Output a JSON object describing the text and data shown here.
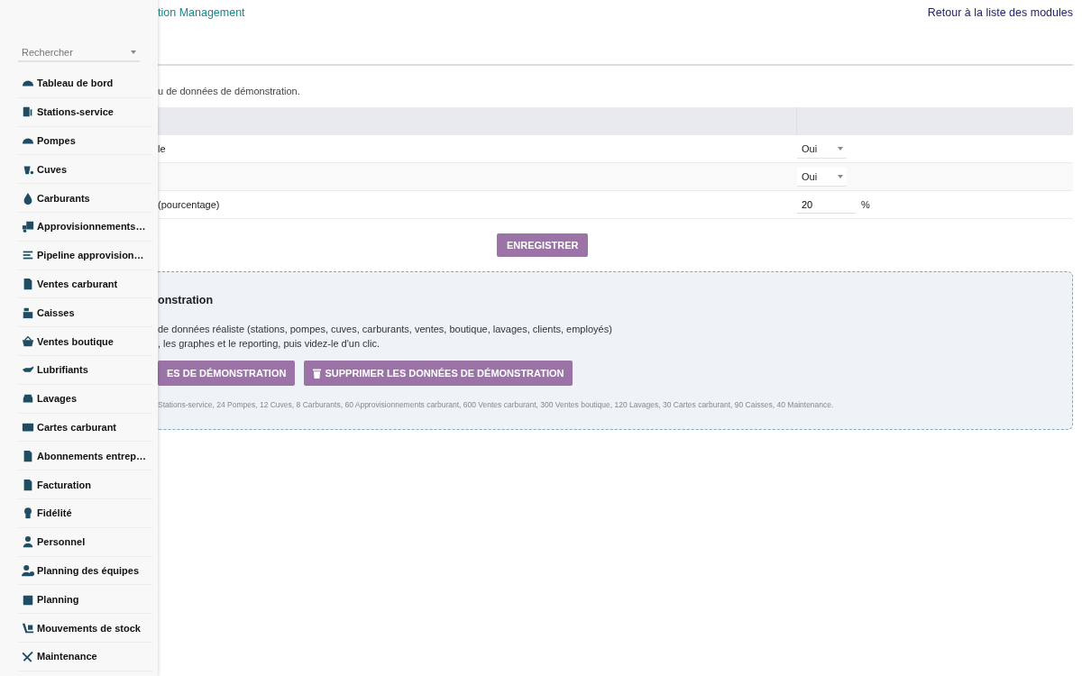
{
  "sidebar": {
    "search": {
      "placeholder": "Rechercher"
    },
    "items": [
      {
        "label": "Tableau de bord"
      },
      {
        "label": "Stations-service"
      },
      {
        "label": "Pompes"
      },
      {
        "label": "Cuves"
      },
      {
        "label": "Carburants"
      },
      {
        "label": "Approvisionnements…"
      },
      {
        "label": "Pipeline approvision…"
      },
      {
        "label": "Ventes carburant"
      },
      {
        "label": "Caisses"
      },
      {
        "label": "Ventes boutique"
      },
      {
        "label": "Lubrifiants"
      },
      {
        "label": "Lavages"
      },
      {
        "label": "Cartes carburant"
      },
      {
        "label": "Abonnements entrep…"
      },
      {
        "label": "Facturation"
      },
      {
        "label": "Fidélité"
      },
      {
        "label": "Personnel"
      },
      {
        "label": "Planning des équipes"
      },
      {
        "label": "Planning"
      },
      {
        "label": "Mouvements de stock"
      },
      {
        "label": "Maintenance"
      }
    ]
  },
  "header": {
    "title": "tion Management",
    "back_link": "Retour à la liste des modules"
  },
  "description": "u de données de démonstration.",
  "settings": {
    "rows": [
      {
        "kind": "select",
        "label": "le",
        "value": "Oui"
      },
      {
        "kind": "select",
        "value": "Oui"
      },
      {
        "kind": "number",
        "label": "(pourcentage)",
        "value": "20",
        "unit": "%"
      }
    ],
    "save_button": "ENREGISTRER"
  },
  "demo": {
    "title": "onstration",
    "lines": [
      "de données réaliste (stations, pompes, cuves, carburants, ventes, boutique, lavages, clients, employés)",
      ", les graphes et le reporting, puis videz-le d'un clic."
    ],
    "buttons": [
      {
        "kind": "create",
        "label": "ES DE DÉMONSTRATION"
      },
      {
        "kind": "delete",
        "label": "SUPPRIMER LES DONNÉES DE DÉMONSTRATION"
      }
    ],
    "note": "Stations-service, 24 Pompes, 12 Cuves, 8 Carburants, 60 Approvisionnements carburant, 600 Ventes carburant, 300 Ventes boutique, 120 Lavages, 30 Cartes carburant, 90 Caisses, 40 Maintenance."
  }
}
